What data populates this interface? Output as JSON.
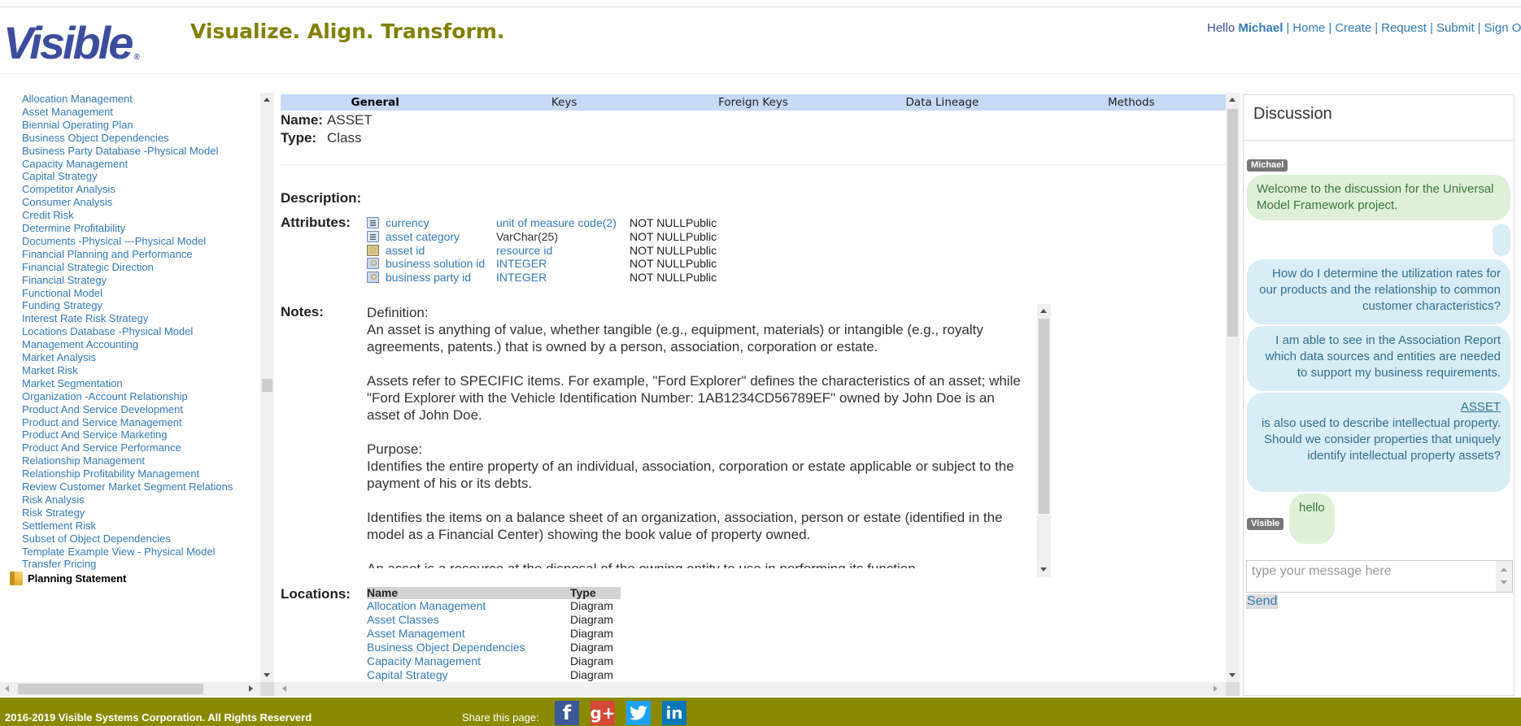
{
  "header": {
    "logo": "Visible",
    "logo_mark": "®",
    "tagline": "Visualize. Align. Transform.",
    "greeting": "Hello",
    "user": "Michael",
    "nav": [
      "Home",
      "Create",
      "Request",
      "Submit",
      "Sign Out"
    ]
  },
  "tree": {
    "items": [
      "Allocation Management",
      "Asset Management",
      "Biennial Operating Plan",
      "Business Object Dependencies",
      "Business Party Database -Physical Model",
      "Capacity Management",
      "Capital Strategy",
      "Competitor Analysis",
      "Consumer Analysis",
      "Credit Risk",
      "Determine Profitability",
      "Documents -Physical ---Physical Model",
      "Financial Planning and Performance",
      "Financial Strategic Direction",
      "Financial Strategy",
      "Functional Model",
      "Funding Strategy",
      "Interest Rate Risk Strategy",
      "Locations Database -Physical Model",
      "Management Accounting",
      "Market Analysis",
      "Market Risk",
      "Market Segmentation",
      "Organization -Account Relationship",
      "Product And Service Development",
      "Product and Service Management",
      "Product And Service Marketing",
      "Product And Service Performance",
      "Relationship Management",
      "Relationship Profitability Management",
      "Review Customer Market Segment Relations",
      "Risk Analysis",
      "Risk Strategy",
      "Settlement Risk",
      "Subset of Object Dependencies",
      "Template Example View - Physical Model",
      "Transfer Pricing"
    ],
    "folder": "Planning Statement"
  },
  "main": {
    "tabs": [
      "General",
      "Keys",
      "Foreign Keys",
      "Data Lineage",
      "Methods"
    ],
    "active_tab": "General",
    "name_label": "Name:",
    "name_value": "ASSET",
    "type_label": "Type:",
    "type_value": "Class",
    "description_label": "Description:",
    "attributes_label": "Attributes:",
    "attributes": [
      {
        "icon": "list",
        "name": "currency",
        "type": "unit of measure code(2)",
        "type_link": true,
        "nullability": "NOT NULL",
        "visibility": "Public"
      },
      {
        "icon": "list",
        "name": "asset category",
        "type": "VarChar(25)",
        "type_link": false,
        "nullability": "NOT NULL",
        "visibility": "Public"
      },
      {
        "icon": "fkey",
        "name": "asset id",
        "type": "resource id",
        "type_link": true,
        "nullability": "NOT NULL",
        "visibility": "Public"
      },
      {
        "icon": "key",
        "name": "business solution id",
        "type": "INTEGER",
        "type_link": true,
        "nullability": "NOT NULL",
        "visibility": "Public"
      },
      {
        "icon": "key",
        "name": "business party id",
        "type": "INTEGER",
        "type_link": true,
        "nullability": "NOT NULL",
        "visibility": "Public"
      }
    ],
    "notes_label": "Notes:",
    "notes": "Definition:\nAn asset is anything of value, whether tangible (e.g., equipment, materials) or intangible (e.g., royalty agreements, patents.) that is owned by a person, association, corporation or estate.\n\nAssets refer to SPECIFIC items. For example, \"Ford Explorer\" defines the characteristics of an asset; while \"Ford Explorer with the Vehicle Identification Number: 1AB1234CD56789EF\" owned by John Doe is an asset of John Doe.\n\nPurpose:\nIdentifies the entire property of an individual, association, corporation or estate applicable or subject to the payment of his or its debts.\n\nIdentifies the items on a balance sheet of an organization, association, person or estate (identified in the model as a Financial Center) showing the book value of property owned.\n\nAn asset is a resource at the disposal of the owning entity to use in performing its function.",
    "locations_label": "Locations:",
    "locations_headers": [
      "Name",
      "Type"
    ],
    "locations": [
      {
        "name": "Allocation Management",
        "type": "Diagram"
      },
      {
        "name": "Asset Classes",
        "type": "Diagram"
      },
      {
        "name": "Asset Management",
        "type": "Diagram"
      },
      {
        "name": "Business Object Dependencies",
        "type": "Diagram"
      },
      {
        "name": "Capacity Management",
        "type": "Diagram"
      },
      {
        "name": "Capital Strategy",
        "type": "Diagram"
      }
    ]
  },
  "discussion": {
    "title": "Discussion",
    "messages": [
      {
        "author": "Michael",
        "text": "Welcome to the discussion for the Universal Model Framework project.",
        "style": "green"
      },
      {
        "author": "",
        "text": "",
        "style": "blue"
      },
      {
        "author": "",
        "text": "How do I determine the utilization rates for our products and the relationship to common customer characteristics?",
        "style": "blue"
      },
      {
        "author": "",
        "text": "I am able to see in the Association Report which data sources and entities are needed to support my business requirements.",
        "style": "blue"
      },
      {
        "author": "",
        "link": "ASSET",
        "text": "is also used to describe intellectual property. Should we consider properties that uniquely identify intellectual property assets?",
        "style": "blue"
      },
      {
        "author": "Visible",
        "text": "hello",
        "style": "green"
      }
    ],
    "input_placeholder": "type your message here",
    "send_label": "Send"
  },
  "footer": {
    "copyright": "2016-2019 Visible Systems Corporation. All Rights Reserverd",
    "share_label": "Share this page:",
    "social": [
      {
        "name": "facebook",
        "glyph": "f"
      },
      {
        "name": "google-plus",
        "glyph": "g+"
      },
      {
        "name": "twitter",
        "glyph": "t"
      },
      {
        "name": "linkedin",
        "glyph": "in"
      }
    ]
  }
}
